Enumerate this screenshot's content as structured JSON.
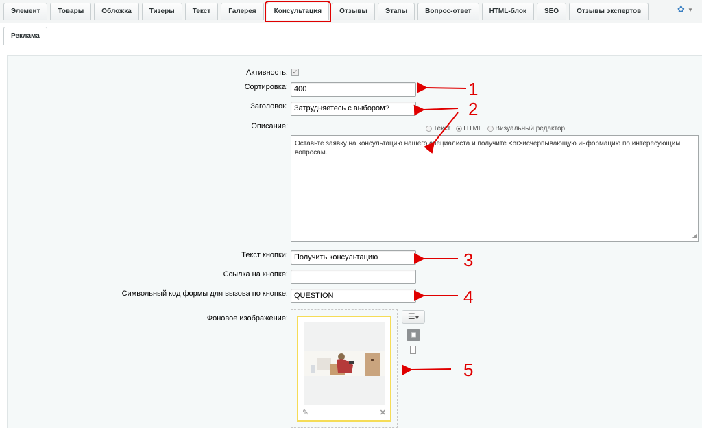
{
  "tabs": [
    "Элемент",
    "Товары",
    "Обложка",
    "Тизеры",
    "Текст",
    "Галерея",
    "Консультация",
    "Отзывы",
    "Этапы",
    "Вопрос-ответ",
    "HTML-блок",
    "SEO",
    "Отзывы экспертов"
  ],
  "active_tab": "Консультация",
  "subtab": "Реклама",
  "form": {
    "active_label": "Активность:",
    "active_checked": true,
    "sort_label": "Сортировка:",
    "sort_value": "400",
    "title_label": "Заголовок:",
    "title_value": "Затрудняетесь с выбором?",
    "desc_label": "Описание:",
    "editor_modes": [
      "Текст",
      "HTML",
      "Визуальный редактор"
    ],
    "editor_selected": "HTML",
    "desc_value": "Оставьте заявку на консультацию нашего специалиста и получите <br>исчерпывающую информацию по интересующим вопросам.",
    "button_text_label": "Текст кнопки:",
    "button_text_value": "Получить консультацию",
    "button_link_label": "Ссылка на кнопке:",
    "button_link_value": "",
    "form_code_label": "Символьный код формы для вызова по кнопке:",
    "form_code_value": "QUESTION",
    "bg_image_label": "Фоновое изображение:"
  },
  "annotations": [
    "1",
    "2",
    "3",
    "4",
    "5"
  ],
  "colors": {
    "annotation": "#e00000",
    "card_border": "#f5dc57",
    "gear": "#3a7fc2"
  },
  "icons": {
    "settings": "gear-icon",
    "edit": "pencil-icon",
    "remove": "close-icon"
  }
}
